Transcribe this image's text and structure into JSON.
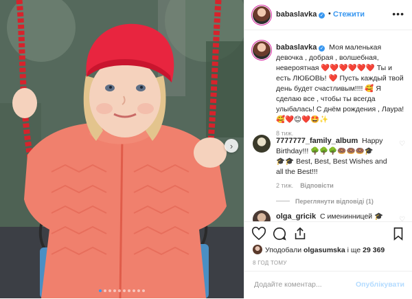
{
  "header": {
    "username": "babaslavka",
    "separator": "•",
    "follow_label": "Стежити",
    "more_icon": "more-options-icon"
  },
  "caption": {
    "username": "babaslavka",
    "text_1": "Моя маленькая девочка , добрая , волшебная, невероятная ",
    "hearts_1": "❤️❤️❤️❤️❤️❤️",
    "text_2": " Ты и есть ЛЮБОВЬ! ",
    "heart_2": "❤️",
    "text_3": " Пусть каждый твой день будет счастливым!!!! 🥰 Я сделаю все , чтобы ты всегда улыбалась! С днём рождения , Лаура! ",
    "emojis_end": "🥰❤️😊❤️🤩✨",
    "time": "8 тиж."
  },
  "comment1": {
    "username": "7777777_family_album",
    "text_1": " Happy Birthday!!! ",
    "emojis_1": "🌳🌳🌳🍩🍩🍩🎓",
    "text_2_prefix": "🎓🎓",
    "text_2": " Best, Best, Best Wishes and all the Best!!!",
    "time": "2 тиж.",
    "reply_label": "Відповісти",
    "view_replies": "Переглянути відповіді (1)"
  },
  "comment2": {
    "username": "olga_gricik",
    "text": " С именинницей 🎓"
  },
  "actions": {
    "like_icon": "heart-outline-icon",
    "comment_icon": "comment-icon",
    "share_icon": "share-icon",
    "save_icon": "bookmark-icon",
    "likes_prefix": "Уподобали ",
    "likes_user": "olgasumska",
    "likes_middle": " і ще ",
    "likes_count": "29 369",
    "time_ago": "8 ГОД ТОМУ"
  },
  "add_comment": {
    "placeholder": "Додайте коментар...",
    "publish_label": "Опублікувати"
  },
  "carousel": {
    "dot_count": 10,
    "active_index": 0
  },
  "colors": {
    "accent": "#3897f0",
    "publish_disabled": "#b3dbff",
    "heart": "#ed4956"
  }
}
